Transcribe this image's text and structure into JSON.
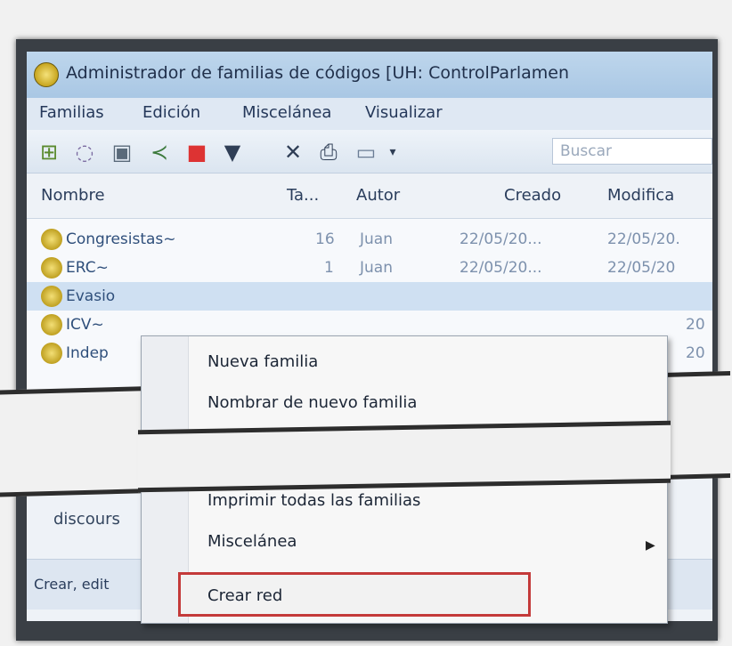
{
  "window": {
    "title": "Administrador de familias de códigos [UH: ControlParlamen"
  },
  "menubar": [
    "Familias",
    "Edición",
    "Miscelánea",
    "Visualizar"
  ],
  "toolbar": {
    "search_placeholder": "Buscar"
  },
  "list": {
    "columns": [
      "Nombre",
      "Ta...",
      "Autor",
      "Creado",
      "Modifica"
    ],
    "rows": [
      {
        "name": "Congresistas~",
        "ta": "16",
        "autor": "Juan",
        "creado": "22/05/20...",
        "modificado": "22/05/20."
      },
      {
        "name": "ERC~",
        "ta": "1",
        "autor": "Juan",
        "creado": "22/05/20...",
        "modificado": "22/05/20"
      },
      {
        "name": "Evasio",
        "ta": "",
        "autor": "",
        "creado": "",
        "modificado": ""
      },
      {
        "name": "ICV~",
        "ta": "",
        "autor": "",
        "creado": "",
        "modificado": "20"
      },
      {
        "name": "Indep",
        "ta": "",
        "autor": "",
        "creado": "",
        "modificado": "20"
      }
    ]
  },
  "lower": {
    "text": "discours"
  },
  "status": {
    "text": "Crear, edit"
  },
  "context_menu": {
    "items": [
      "Nueva familia",
      "Nombrar de nuevo familia",
      "Imprimir todas las familias",
      "Miscelánea",
      "Crear red"
    ]
  },
  "colors": {
    "highlight_border": "#c43a3a",
    "selected_row": "#cfe0f2",
    "titlebar": "#bed6ec"
  }
}
